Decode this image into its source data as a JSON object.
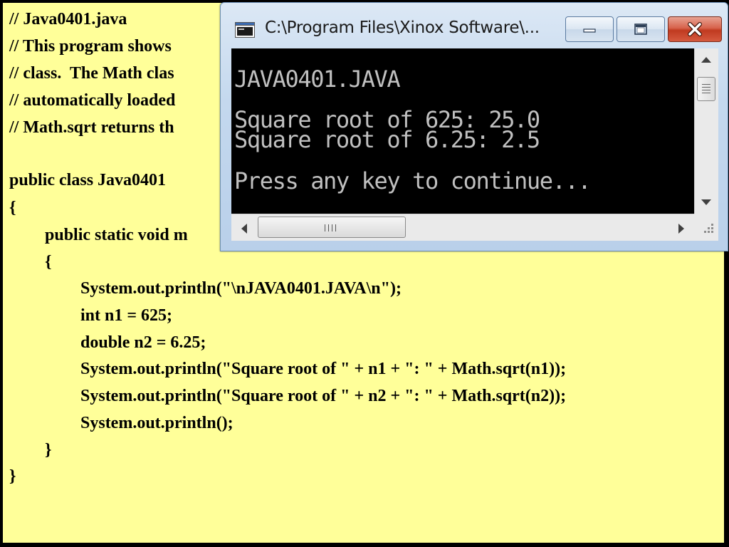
{
  "code": {
    "lines": [
      "// Java0401.java",
      "// This program shows",
      "// class.  The Math clas",
      "// automatically loaded",
      "// Math.sqrt returns th",
      "public class Java0401",
      "{",
      "public static void m",
      "{",
      "System.out.println(\"\\nJAVA0401.JAVA\\n\");",
      "int n1 = 625;",
      "double n2 = 6.25;",
      "System.out.println(\"Square root of \" + n1 + \": \" + Math.sqrt(n1));",
      "System.out.println(\"Square root of \" + n2 + \": \" + Math.sqrt(n2));",
      "System.out.println();",
      "}",
      "}"
    ]
  },
  "console": {
    "title": "C:\\Program Files\\Xinox Software\\...",
    "output": [
      "JAVA0401.JAVA",
      "Square root of 625: 25.0",
      "Square root of 6.25: 2.5",
      "Press any key to continue..."
    ],
    "icons": {
      "window": "console-window-icon",
      "minimize": "minimize-icon",
      "maximize": "maximize-icon",
      "close": "close-icon"
    }
  },
  "colors": {
    "slide_background": "#ffff99",
    "console_background": "#000000",
    "console_text": "#c0c0c0",
    "close_button": "#c94a30"
  }
}
